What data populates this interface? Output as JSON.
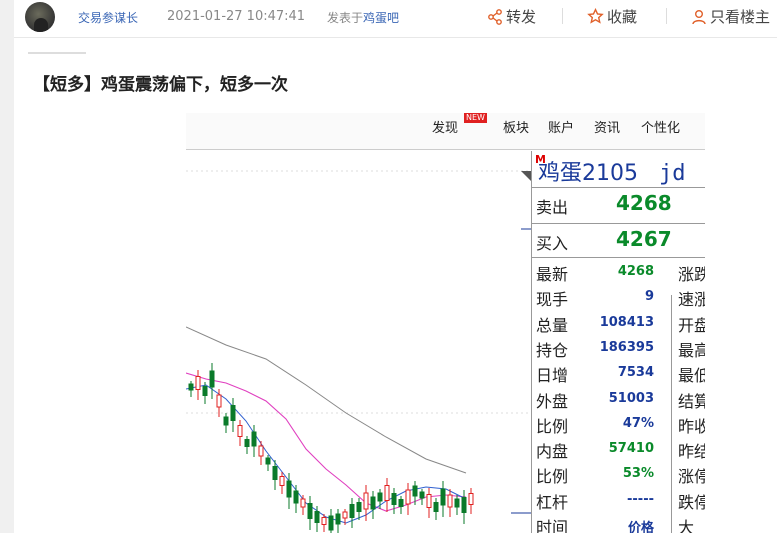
{
  "header": {
    "author": "交易参谋长",
    "datetime": "2021-01-27 10:47:41",
    "posted_in_prefix": "发表于",
    "forum": "鸡蛋吧",
    "actions": [
      {
        "icon": "share-icon",
        "label": "转发"
      },
      {
        "icon": "star-icon",
        "label": "收藏"
      },
      {
        "icon": "user-icon",
        "label": "只看楼主"
      }
    ]
  },
  "post": {
    "title": "【短多】鸡蛋震荡偏下，短多一次"
  },
  "screenshot": {
    "menu": [
      "发现",
      "板块",
      "账户",
      "资讯",
      "个性化"
    ],
    "new_badge": "NEW",
    "contract_marker": "M",
    "contract": "鸡蛋2105",
    "contract_suffix": "jd",
    "sell_label": "卖出",
    "sell_price": "4268",
    "buy_label": "买入",
    "buy_price": "4267",
    "quote_rows": [
      {
        "label": "最新",
        "value": "4268",
        "color": "#0a8a2a",
        "right": "涨跌"
      },
      {
        "label": "现手",
        "value": "9",
        "color": "#1a3a9a",
        "right": "速涨"
      },
      {
        "label": "总量",
        "value": "108413",
        "color": "#1a3a9a",
        "right": "开盘"
      },
      {
        "label": "持仓",
        "value": "186395",
        "color": "#1a3a9a",
        "right": "最高"
      },
      {
        "label": "日增",
        "value": "7534",
        "color": "#1a3a9a",
        "right": "最低"
      },
      {
        "label": "外盘",
        "value": "51003",
        "color": "#1a3a9a",
        "right": "结算"
      },
      {
        "label": "比例",
        "value": "47%",
        "color": "#1a3a9a",
        "right": "昨收"
      },
      {
        "label": "内盘",
        "value": "57410",
        "color": "#0a8a2a",
        "right": "昨结"
      },
      {
        "label": "比例",
        "value": "53%",
        "color": "#0a8a2a",
        "right": "涨停"
      },
      {
        "label": "杠杆",
        "value": "-----",
        "color": "#1a3a9a",
        "right": "跌停"
      },
      {
        "label": "时间",
        "value": "价格",
        "color": "#1a3a9a",
        "right": "大"
      }
    ]
  }
}
